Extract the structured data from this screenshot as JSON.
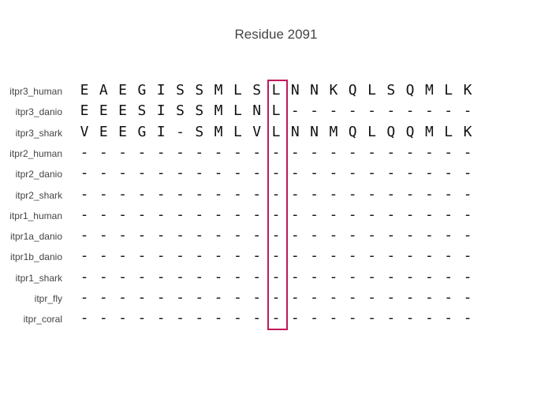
{
  "title": "Residue 2091",
  "highlight_column": 10,
  "highlight_color": "#c2185b",
  "alignment": [
    {
      "name": "itpr3_human",
      "seq": "EAEGISSMLSLNNKQLSQMLK"
    },
    {
      "name": "itpr3_danio",
      "seq": "EEESISSMLNL----------"
    },
    {
      "name": "itpr3_shark",
      "seq": "VEEGI-SMLVLNNMQLQQMLK"
    },
    {
      "name": "itpr2_human",
      "seq": "---------------------"
    },
    {
      "name": "itpr2_danio",
      "seq": "---------------------"
    },
    {
      "name": "itpr2_shark",
      "seq": "---------------------"
    },
    {
      "name": "itpr1_human",
      "seq": "---------------------"
    },
    {
      "name": "itpr1a_danio",
      "seq": "---------------------"
    },
    {
      "name": "itpr1b_danio",
      "seq": "---------------------"
    },
    {
      "name": "itpr1_shark",
      "seq": "---------------------"
    },
    {
      "name": "itpr_fly",
      "seq": "---------------------"
    },
    {
      "name": "itpr_coral",
      "seq": "---------------------"
    }
  ]
}
